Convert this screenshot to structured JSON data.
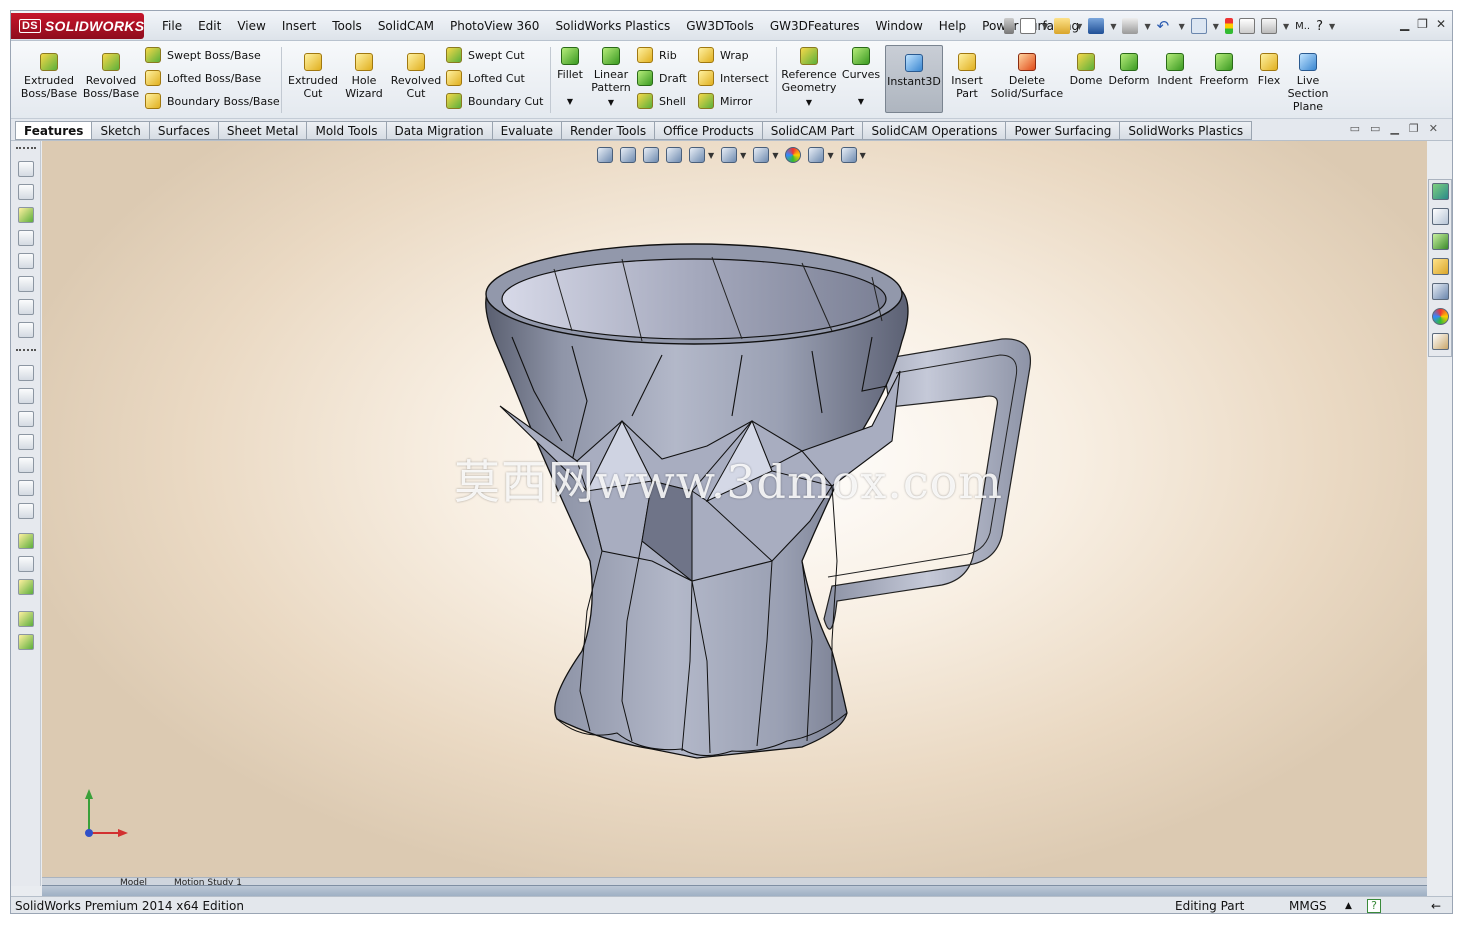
{
  "app": {
    "logo_text": "SOLIDWORKS",
    "logo_mark": "DS"
  },
  "menu": [
    "File",
    "Edit",
    "View",
    "Insert",
    "Tools",
    "SolidCAM",
    "PhotoView 360",
    "SolidWorks Plastics",
    "GW3DTools",
    "GW3DFeatures",
    "Window",
    "Help",
    "Power Surfacing"
  ],
  "quick_access": {
    "extra_label": "M.."
  },
  "ribbon": {
    "extruded_boss": [
      "Extruded",
      "Boss/Base"
    ],
    "revolved_boss": [
      "Revolved",
      "Boss/Base"
    ],
    "swept_boss": "Swept Boss/Base",
    "lofted_boss": "Lofted Boss/Base",
    "boundary_boss": "Boundary Boss/Base",
    "extruded_cut": [
      "Extruded",
      "Cut"
    ],
    "hole_wizard": [
      "Hole",
      "Wizard"
    ],
    "revolved_cut": [
      "Revolved",
      "Cut"
    ],
    "swept_cut": "Swept Cut",
    "lofted_cut": "Lofted Cut",
    "boundary_cut": "Boundary Cut",
    "fillet": "Fillet",
    "linear_pattern": [
      "Linear",
      "Pattern"
    ],
    "rib": "Rib",
    "draft": "Draft",
    "shell": "Shell",
    "wrap": "Wrap",
    "intersect": "Intersect",
    "mirror": "Mirror",
    "reference_geometry": [
      "Reference",
      "Geometry"
    ],
    "curves": "Curves",
    "instant3d": "Instant3D",
    "insert_part": [
      "Insert",
      "Part"
    ],
    "delete_solid": [
      "Delete",
      "Solid/Surface"
    ],
    "dome": "Dome",
    "deform": "Deform",
    "indent": "Indent",
    "freeform": "Freeform",
    "flex": "Flex",
    "live_section": [
      "Live",
      "Section",
      "Plane"
    ]
  },
  "tabs": [
    "Features",
    "Sketch",
    "Surfaces",
    "Sheet Metal",
    "Mold Tools",
    "Data Migration",
    "Evaluate",
    "Render Tools",
    "Office Products",
    "SolidCAM Part",
    "SolidCAM Operations",
    "Power Surfacing",
    "SolidWorks Plastics"
  ],
  "active_tab": "Features",
  "watermark": "莫西网www.3dmox.com",
  "bottom_tabs": [
    "Model",
    "Motion Study 1"
  ],
  "status": {
    "edition": "SolidWorks Premium 2014 x64 Edition",
    "mode": "Editing Part",
    "units": "MMGS"
  },
  "colors": {
    "brand": "#b0122a",
    "model": "#8e94a6"
  }
}
